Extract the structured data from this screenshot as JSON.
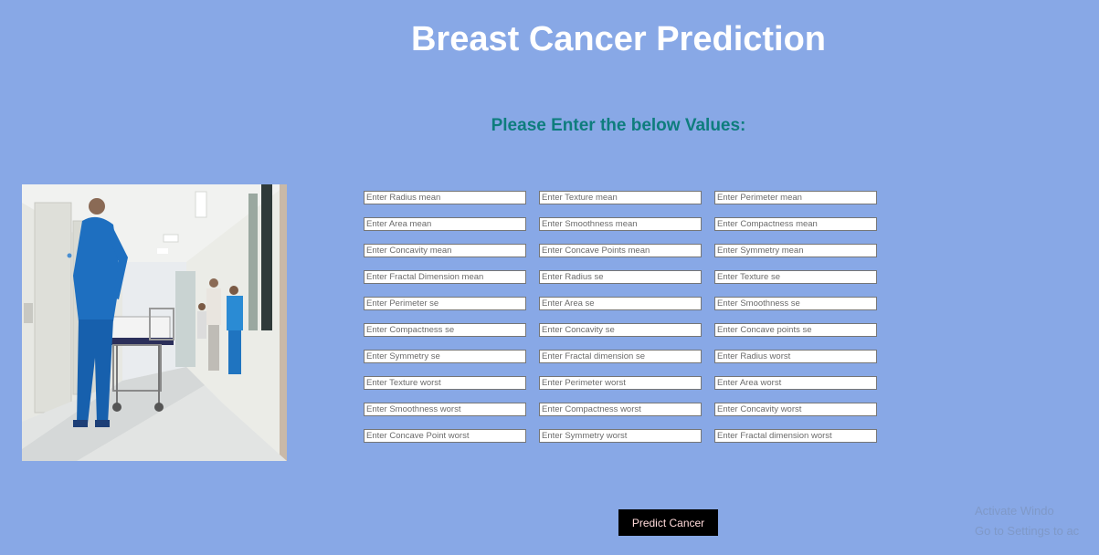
{
  "header": {
    "title": "Breast Cancer Prediction",
    "subtitle": "Please Enter the below Values:"
  },
  "image": {
    "alt": "hospital-corridor-photo"
  },
  "form": {
    "fields": [
      {
        "placeholder": "Enter Radius mean"
      },
      {
        "placeholder": "Enter Texture mean"
      },
      {
        "placeholder": "Enter Perimeter mean"
      },
      {
        "placeholder": "Enter Area mean"
      },
      {
        "placeholder": "Enter Smoothness mean"
      },
      {
        "placeholder": "Enter Compactness mean"
      },
      {
        "placeholder": "Enter Concavity mean"
      },
      {
        "placeholder": "Enter Concave Points mean"
      },
      {
        "placeholder": "Enter Symmetry mean"
      },
      {
        "placeholder": "Enter Fractal Dimension mean"
      },
      {
        "placeholder": "Enter Radius se"
      },
      {
        "placeholder": "Enter Texture se"
      },
      {
        "placeholder": "Enter Perimeter se"
      },
      {
        "placeholder": "Enter Area se"
      },
      {
        "placeholder": "Enter Smoothness se"
      },
      {
        "placeholder": "Enter Compactness se"
      },
      {
        "placeholder": "Enter Concavity se"
      },
      {
        "placeholder": "Enter Concave points se"
      },
      {
        "placeholder": "Enter Symmetry se"
      },
      {
        "placeholder": "Enter Fractal dimension se"
      },
      {
        "placeholder": "Enter Radius worst"
      },
      {
        "placeholder": "Enter Texture worst"
      },
      {
        "placeholder": "Enter Perimeter worst"
      },
      {
        "placeholder": "Enter Area worst"
      },
      {
        "placeholder": "Enter Smoothness worst"
      },
      {
        "placeholder": "Enter Compactness worst"
      },
      {
        "placeholder": "Enter Concavity worst"
      },
      {
        "placeholder": "Enter Concave Point worst"
      },
      {
        "placeholder": "Enter Symmetry worst"
      },
      {
        "placeholder": "Enter Fractal dimension worst"
      }
    ],
    "submit_label": "Predict Cancer"
  },
  "watermark": {
    "line1": "Activate Windo",
    "line2": "Go to Settings to ac"
  },
  "colors": {
    "background": "#88a8e6",
    "title": "#ffffff",
    "subtitle": "#0e7d7d",
    "button_bg": "#000000",
    "button_text": "#ffd9d9"
  }
}
